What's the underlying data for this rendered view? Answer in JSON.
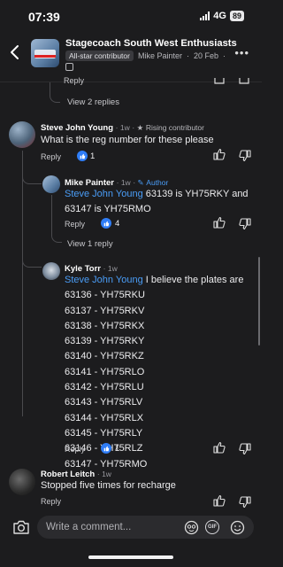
{
  "status": {
    "time": "07:39",
    "network": "4G",
    "battery": "89"
  },
  "header": {
    "title": "Stagecoach South West Enthusiasts",
    "badge": "All-star contributor",
    "poster": "Mike Painter",
    "date": "20 Feb",
    "separator": "·"
  },
  "thread": {
    "top_reply_label": "Reply",
    "view_replies_top": "View 2 replies"
  },
  "comments": [
    {
      "name": "Steve John Young",
      "time": "1w",
      "role": "Rising contributor",
      "text": "What is the reg number for these please",
      "reply": "Reply",
      "likes": "1"
    },
    {
      "name": "Mike Painter",
      "time": "1w",
      "role": "Author",
      "mention": "Steve John Young",
      "text": " 63139 is YH75RKY and 63147 is YH75RMO",
      "reply": "Reply",
      "likes": "4",
      "view_replies": "View 1 reply"
    },
    {
      "name": "Kyle Torr",
      "time": "1w",
      "mention": "Steve John Young",
      "text": " I believe the plates are",
      "plates": [
        "63136 - YH75RKU",
        "63137 - YH75RKV",
        "63138 - YH75RKX",
        "63139 - YH75RKY",
        "63140 - YH75RKZ",
        "63141 - YH75RLO",
        "63142 - YH75RLU",
        "63143 - YH75RLV",
        "63144 - YH75RLX",
        "63145 - YH75RLY",
        "63146 - YH75RLZ",
        "63147 - YH75RMO"
      ],
      "reply": "Reply",
      "likes": "1"
    },
    {
      "name": "Robert Leitch",
      "time": "1w",
      "text": "Stopped five times for recharge",
      "reply": "Reply"
    }
  ],
  "composer": {
    "placeholder": "Write a comment..."
  },
  "icons": {
    "back": "chevron-left-icon",
    "more": "more-horizontal-icon",
    "like": "thumbs-up-icon",
    "dislike": "thumbs-down-icon",
    "camera": "camera-icon",
    "avatar_sticker": "avatar-sticker-icon",
    "gif": "gif-icon",
    "emoji": "emoji-icon"
  },
  "colors": {
    "accent": "#4a9df7",
    "like_bubble": "#2f7df6",
    "background": "#1c1c1e"
  }
}
